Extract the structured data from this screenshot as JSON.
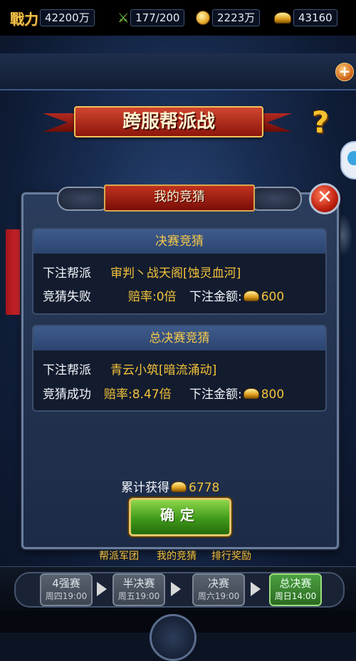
{
  "resources": {
    "power_label": "戰力",
    "power_value": "42200万",
    "stamina_value": "177/200",
    "coins_value": "2223万",
    "ingots_value": "43160"
  },
  "title": "跨服帮派战",
  "help_symbol": "?",
  "dialog": {
    "header": "我的竞猜",
    "close_symbol": "✕",
    "cards": [
      {
        "title": "决赛竞猜",
        "bet_label": "下注帮派",
        "bet_value": "审判丶战天阁[蚀灵血河]",
        "result": "竞猜失败",
        "odds": "赔率:0倍",
        "amount_label": "下注金额:",
        "amount": "600"
      },
      {
        "title": "总决赛竞猜",
        "bet_label": "下注帮派",
        "bet_value": "青云小筑[暗流涌动]",
        "result": "竞猜成功",
        "odds": "赔率:8.47倍",
        "amount_label": "下注金额:",
        "amount": "800"
      }
    ],
    "total_label": "累计获得",
    "total_value": "6778",
    "confirm_label": "确定"
  },
  "tabs": [
    "帮派军团",
    "我的竞猜",
    "排行奖励"
  ],
  "stages": [
    {
      "name": "4强赛",
      "time": "周四19:00"
    },
    {
      "name": "半决赛",
      "time": "周五19:00"
    },
    {
      "name": "决赛",
      "time": "周六19:00"
    },
    {
      "name": "总决赛",
      "time": "周日14:00"
    }
  ],
  "colors": {
    "accent_gold": "#f3c23a",
    "confirm_green": "#3f9a1a",
    "header_red": "#c0321e"
  }
}
